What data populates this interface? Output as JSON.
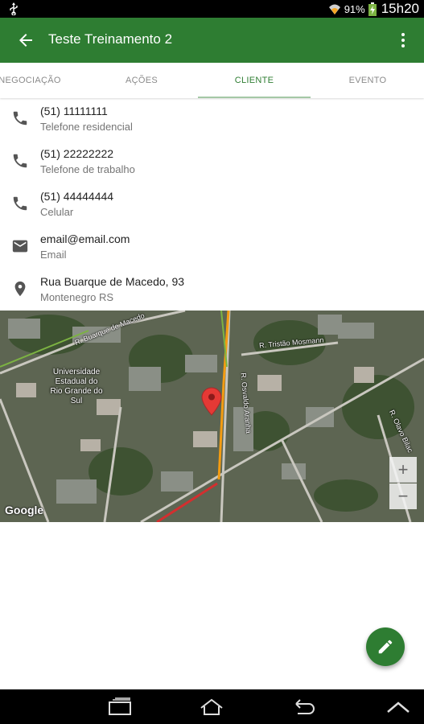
{
  "status_bar": {
    "battery_percent": "91%",
    "clock": "15h20",
    "icons": [
      "usb-icon",
      "wifi-icon",
      "battery-charging-icon"
    ]
  },
  "app_bar": {
    "title": "Teste Treinamento 2",
    "icons": [
      "arrow-back-icon",
      "more-vert-icon"
    ]
  },
  "tabs": [
    {
      "label": "NEGOCIAÇÃO",
      "active": false
    },
    {
      "label": "AÇÕES",
      "active": false
    },
    {
      "label": "CLIENTE",
      "active": true
    },
    {
      "label": "EVENTO",
      "active": false
    }
  ],
  "contacts": [
    {
      "icon": "phone-icon",
      "primary": "(51) 11111111",
      "secondary": "Telefone residencial"
    },
    {
      "icon": "phone-icon",
      "primary": "(51) 22222222",
      "secondary": "Telefone de trabalho"
    },
    {
      "icon": "phone-icon",
      "primary": "(51) 44444444",
      "secondary": "Celular"
    },
    {
      "icon": "email-icon",
      "primary": "email@email.com",
      "secondary": "Email"
    },
    {
      "icon": "location-icon",
      "primary": "Rua Buarque de Macedo, 93",
      "secondary": "Montenegro RS"
    }
  ],
  "map": {
    "poi_label": "Universidade Estadual do Rio Grande do Sul",
    "street_labels": [
      "R. Tristão Mosmann",
      "R. Buarque de Macedo",
      "R. Osvaldo Aranha",
      "R. Olavo Bilac"
    ],
    "attribution": "Google",
    "zoom_in": "+",
    "zoom_out": "−"
  },
  "fab": {
    "icon": "edit-icon"
  },
  "colors": {
    "primary": "#2e7d32",
    "tab_active": "#2e7d32",
    "tab_indicator": "#a5c8a6",
    "marker": "#e53935"
  }
}
